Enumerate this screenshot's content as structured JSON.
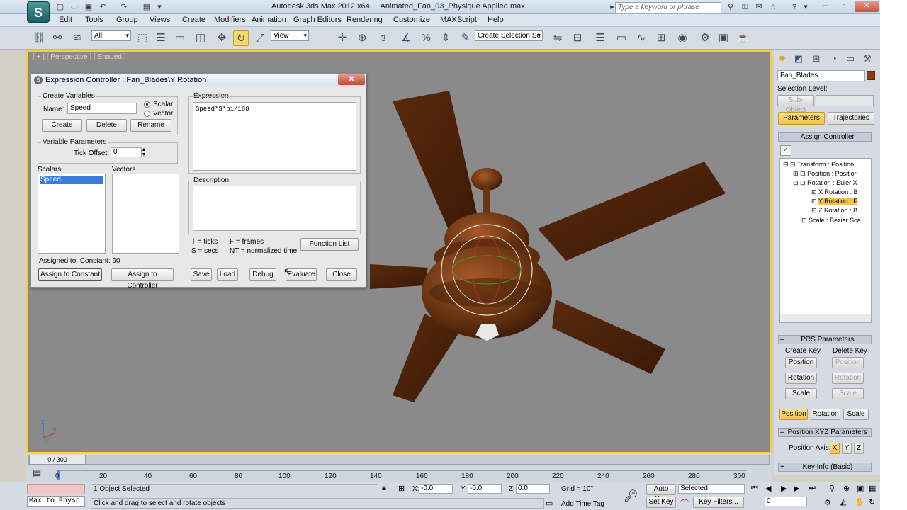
{
  "title": {
    "app": "Autodesk 3ds Max 2012 x64",
    "file": "Animated_Fan_03_Physique Applied.max",
    "search_placeholder": "Type a keyword or phrase",
    "logo": "S"
  },
  "menu": [
    "Edit",
    "Tools",
    "Group",
    "Views",
    "Create",
    "Modifiers",
    "Animation",
    "Graph Editors",
    "Rendering",
    "Customize",
    "MAXScript",
    "Help"
  ],
  "toolbar": {
    "filter": "All",
    "ref_coord": "View",
    "snap_label": "3",
    "selection_set": "Create Selection Se"
  },
  "viewport": {
    "label": "[ + ] [ Perspective ] [ Shaded ]",
    "axis_x": "x",
    "axis_y": "y",
    "axis_z": "z"
  },
  "dialog": {
    "title": "Expression Controller : Fan_Blades\\Y Rotation",
    "create_variables": "Create Variables",
    "name_label": "Name:",
    "name_value": "Speed",
    "scalar_label": "Scalar",
    "vector_label": "Vector",
    "create_btn": "Create",
    "delete_btn": "Delete",
    "rename_btn": "Rename",
    "variable_parameters": "Variable Parameters",
    "tick_offset_label": "Tick Offset:",
    "tick_offset_value": "0",
    "scalars_label": "Scalars",
    "vectors_label": "Vectors",
    "scalars": [
      "Speed"
    ],
    "assigned_to": "Assigned to:  Constant: 90",
    "assign_constant_btn": "Assign to Constant",
    "assign_controller_btn": "Assign to Controller",
    "expression_label": "Expression",
    "expression_value": "Speed*S*pi/180",
    "description_label": "Description",
    "legend_t": "T = ticks",
    "legend_f": "F = frames",
    "legend_s": "S = secs",
    "legend_nt": "NT = normalized time",
    "function_list_btn": "Function List",
    "save_btn": "Save",
    "load_btn": "Load",
    "debug_btn": "Debug",
    "evaluate_btn": "Evaluate",
    "close_btn": "Close"
  },
  "cmdpanel": {
    "object_name": "Fan_Blades",
    "selection_level": "Selection Level:",
    "sub_object": "Sub-Object",
    "parameters_tab": "Parameters",
    "trajectories_tab": "Trajectories",
    "assign_controller": "Assign Controller",
    "tree": [
      "Transform : Position",
      "Position : Positior",
      "Rotation : Euler X",
      "X Rotation : B",
      "Y Rotation : F",
      "Z Rotation : B",
      "Scale : Bezier Sca"
    ],
    "prs_parameters": "PRS Parameters",
    "create_key": "Create Key",
    "delete_key": "Delete Key",
    "position": "Position",
    "rotation": "Rotation",
    "scale": "Scale",
    "position_xyz": "Position XYZ Parameters",
    "position_axis": "Position Axis:",
    "axis_x": "X",
    "axis_y": "Y",
    "axis_z": "Z",
    "key_info": "Key Info (Basic)"
  },
  "timeline": {
    "frame_counter": "0 / 300",
    "ticks": [
      "0",
      "20",
      "40",
      "60",
      "80",
      "100",
      "120",
      "140",
      "160",
      "180",
      "200",
      "220",
      "240",
      "260",
      "280",
      "300"
    ]
  },
  "status": {
    "maxscript": "Max to Physc",
    "selected": "1 Object Selected",
    "prompt": "Click and drag to select and rotate objects",
    "x_label": "X:",
    "x_value": "-0.0",
    "y_label": "Y:",
    "y_value": "-0.0",
    "z_label": "Z:",
    "z_value": "0.0",
    "grid": "Grid = 10\"",
    "add_time_tag": "Add Time Tag",
    "auto_key": "Auto Key",
    "set_key": "Set Key",
    "selected_dropdown": "Selected",
    "key_filters": "Key Filters...",
    "frame_value": "0"
  },
  "colors": {
    "viewport_border": "#f2d23a",
    "fan_wood": "#6b3512",
    "highlight": "#f2c24a"
  }
}
